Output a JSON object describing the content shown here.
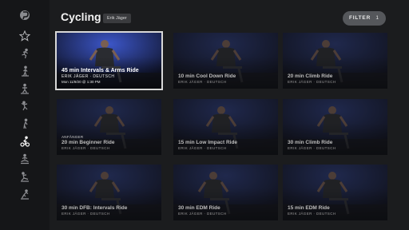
{
  "header": {
    "title": "Cycling",
    "instructor_chip": "Erik Jäger",
    "filter_label": "FILTER",
    "filter_count": "1"
  },
  "sidebar": {
    "items": [
      {
        "icon": "peloton-logo-icon"
      },
      {
        "icon": "star-icon"
      },
      {
        "icon": "running-icon"
      },
      {
        "icon": "walking-icon"
      },
      {
        "icon": "bootcamp-icon"
      },
      {
        "icon": "yoga-icon"
      },
      {
        "icon": "strength-icon"
      },
      {
        "icon": "cycling-icon"
      },
      {
        "icon": "meditation-icon"
      },
      {
        "icon": "stretching-icon"
      },
      {
        "icon": "cardio-icon"
      }
    ]
  },
  "classes": [
    {
      "title": "45 min Intervals & Arms Ride",
      "instructor": "ERIK JÄGER · DEUTSCH",
      "date": "Mon 11/9/20 @ 1:30 PM",
      "badge": "",
      "featured": true
    },
    {
      "title": "10 min Cool Down Ride",
      "instructor": "ERIK JÄGER · DEUTSCH",
      "date": "",
      "badge": "",
      "featured": false
    },
    {
      "title": "20 min Climb Ride",
      "instructor": "ERIK JÄGER · DEUTSCH",
      "date": "",
      "badge": "",
      "featured": false
    },
    {
      "title": "20 min Beginner Ride",
      "instructor": "ERIK JÄGER · DEUTSCH",
      "date": "",
      "badge": "ANFÄNGER",
      "featured": false
    },
    {
      "title": "15 min Low Impact Ride",
      "instructor": "ERIK JÄGER · DEUTSCH",
      "date": "",
      "badge": "",
      "featured": false
    },
    {
      "title": "30 min Climb Ride",
      "instructor": "ERIK JÄGER · DEUTSCH",
      "date": "",
      "badge": "",
      "featured": false
    },
    {
      "title": "30 min DFB: Intervals Ride",
      "instructor": "ERIK JÄGER · DEUTSCH",
      "date": "",
      "badge": "",
      "featured": false
    },
    {
      "title": "30 min EDM Ride",
      "instructor": "ERIK JÄGER · DEUTSCH",
      "date": "",
      "badge": "",
      "featured": false
    },
    {
      "title": "15 min EDM Ride",
      "instructor": "ERIK JÄGER · DEUTSCH",
      "date": "",
      "badge": "",
      "featured": false
    }
  ],
  "colors": {
    "background": "#1b1c1e",
    "sidebar": "#151618",
    "studio_blue": "#2a3a7a",
    "filter_pill": "#55575b"
  }
}
